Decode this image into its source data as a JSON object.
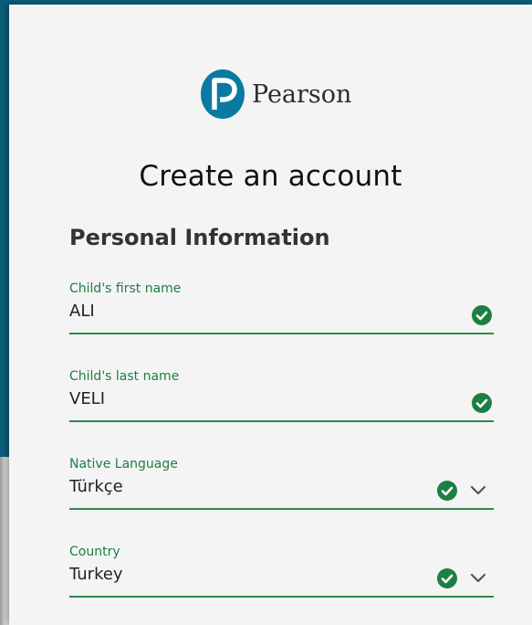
{
  "brand": {
    "name": "Pearson",
    "color": "#0b7aa2"
  },
  "page": {
    "title": "Create an account",
    "section": "Personal Information"
  },
  "fields": [
    {
      "label": "Child's first name",
      "value": "ALI",
      "type": "text"
    },
    {
      "label": "Child's last name",
      "value": "VELI",
      "type": "text"
    },
    {
      "label": "Native Language",
      "value": "Türkçe",
      "type": "select"
    },
    {
      "label": "Country",
      "value": "Turkey",
      "type": "select"
    }
  ],
  "colors": {
    "valid": "#1d7f43",
    "accent": "#0b5e78"
  },
  "icons": {
    "valid": "check-circle-icon",
    "dropdown": "chevron-down-icon"
  }
}
